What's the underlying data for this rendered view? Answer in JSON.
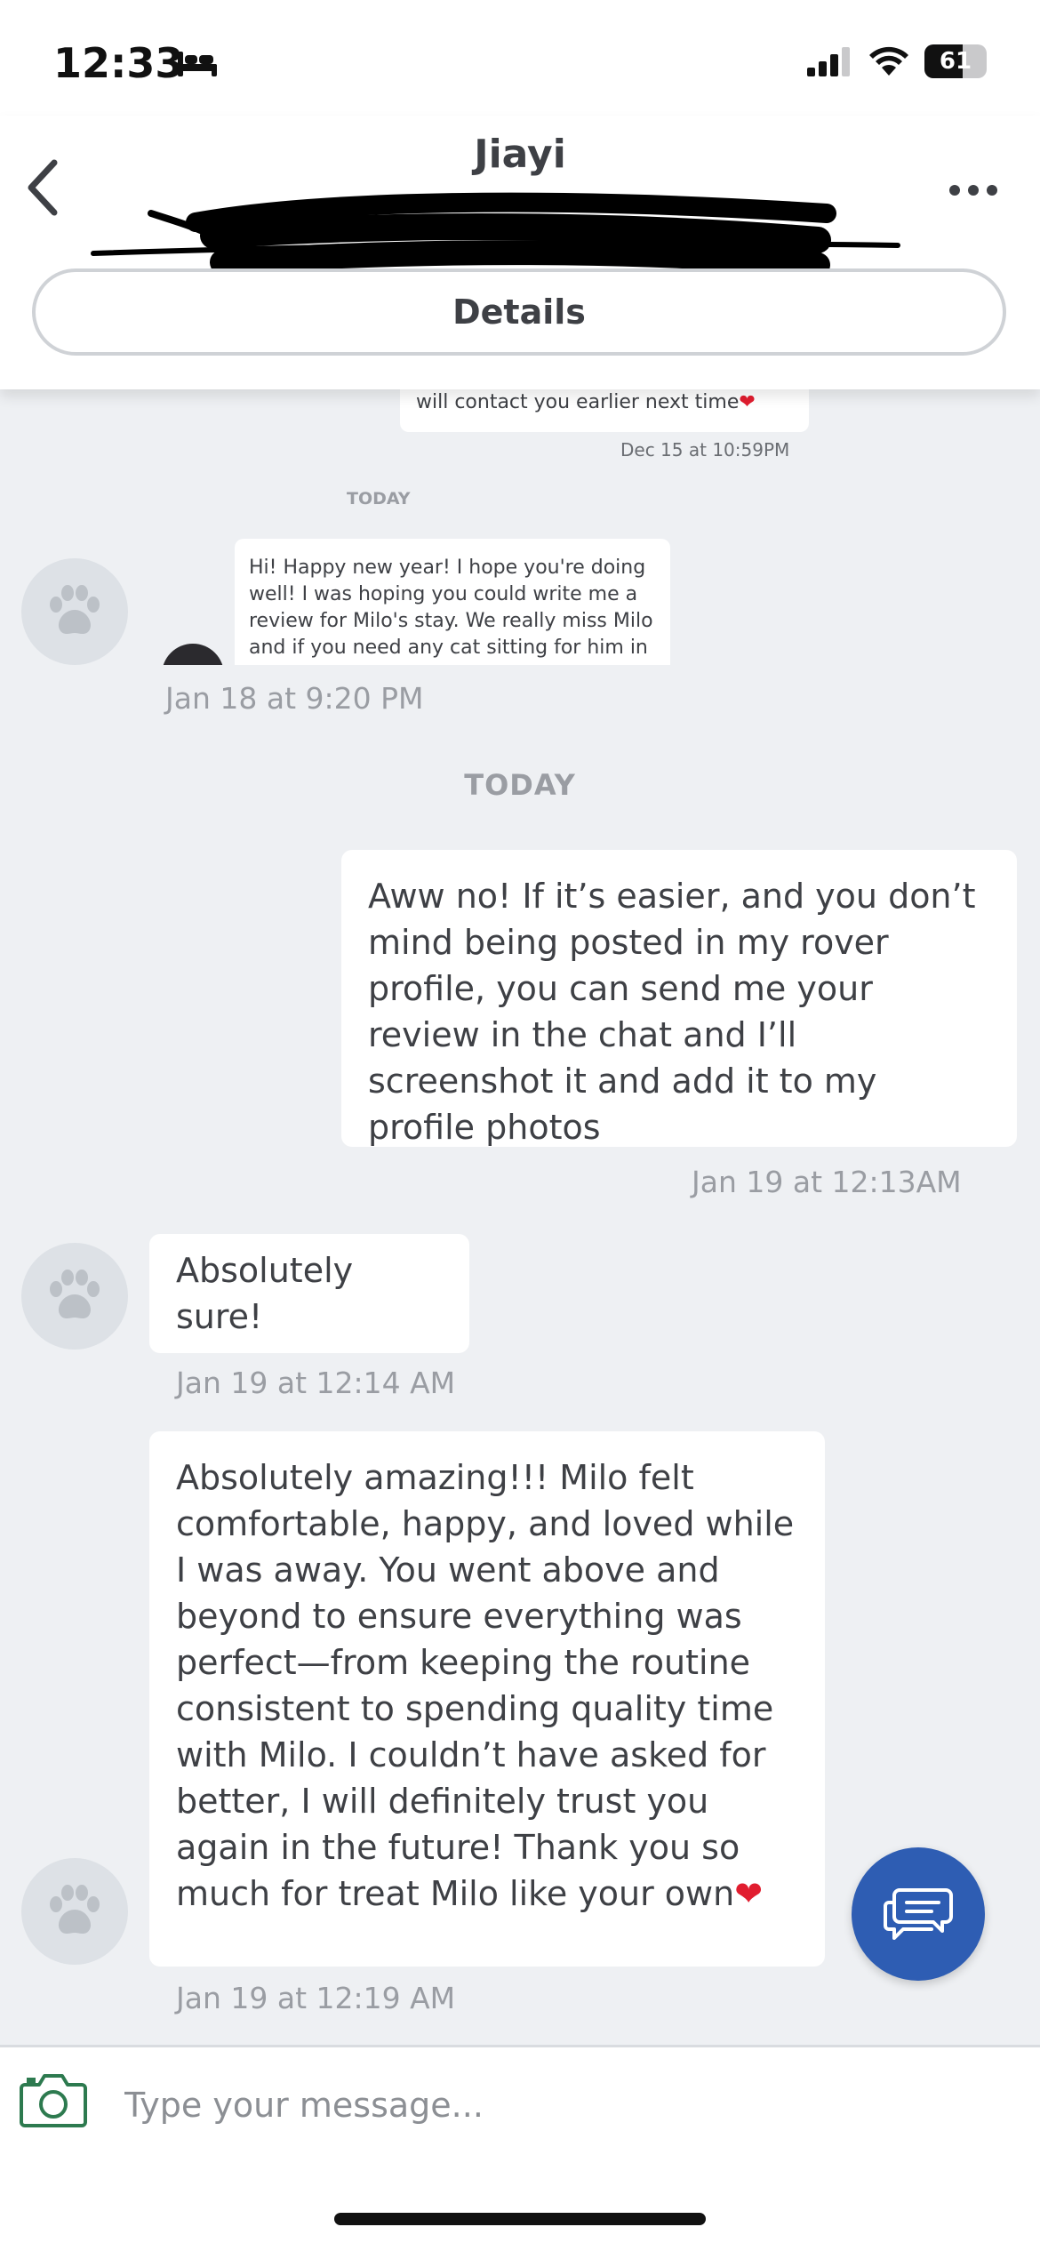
{
  "status_bar": {
    "time": "12:33",
    "battery": "61",
    "battery_level": 0.61
  },
  "header": {
    "title": "Jiayi",
    "details_label": "Details"
  },
  "colors": {
    "accent": "#2e5db3",
    "bubble": "#ffffff",
    "background": "#eef0f3",
    "camera": "#2d7a4f"
  },
  "thread": {
    "prev_message_tail": "will contact you earlier next time",
    "prev_timestamp": "Dec 15 at 10:59PM",
    "screenshot_day_label": "TODAY",
    "screenshot_message": "Hi! Happy new year! I hope you're doing well! I was hoping you could write me a review for Milo's stay. We really miss Milo and if you need any cat sitting for him in",
    "screenshot_timestamp": "Jan 18 at 9:20 PM",
    "day_label": "TODAY",
    "messages": [
      {
        "text": "Aww no! If it’s easier, and you don’t mind being posted in my rover profile, you can send me your review in the chat and I’ll screenshot it and add it to my profile photos",
        "timestamp": "Jan 19 at 12:13AM"
      },
      {
        "text": "Absolutely sure!",
        "timestamp": "Jan 19 at 12:14 AM"
      },
      {
        "text": "Absolutely amazing!!! Milo felt comfortable, happy, and loved while I was away. You went above and beyond to ensure everything was perfect—from keeping the routine consistent to spending quality time with Milo. I couldn’t have asked for better, I will definitely trust you again in the future! Thank you so much for treat Milo like your own",
        "timestamp": "Jan 19 at 12:19 AM"
      }
    ]
  },
  "composer": {
    "placeholder": "Type your message..."
  },
  "icons": {
    "back": "chevron-left-icon",
    "more": "more-dots-icon",
    "avatar": "paw-icon",
    "fab": "chat-bubbles-icon",
    "camera": "camera-icon",
    "heart": "red-heart-emoji"
  }
}
